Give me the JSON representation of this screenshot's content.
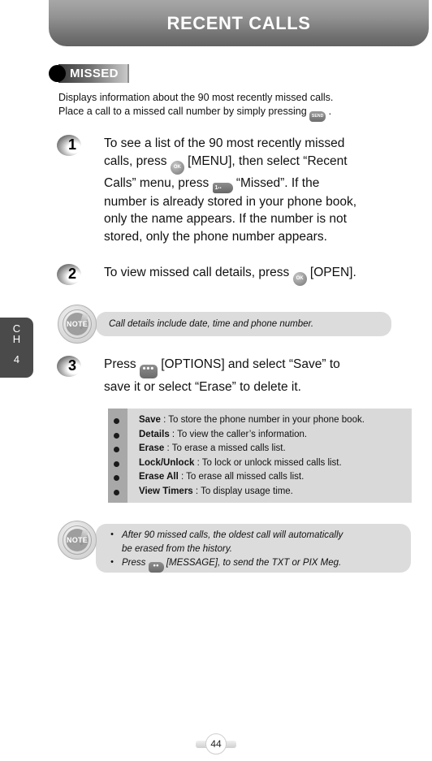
{
  "header": {
    "title": "RECENT CALLS"
  },
  "chapter_tab": {
    "letter1": "C",
    "letter2": "H",
    "number": "4"
  },
  "section": {
    "badge_label": "MISSED",
    "intro_line1": "Displays information about the 90 most recently missed calls.",
    "intro_line2a": "Place a call to a missed call number by simply pressing",
    "intro_line2b": ".",
    "intro_key": "SEND"
  },
  "steps": [
    {
      "number": "1",
      "line1": "To see a list of the 90 most recently missed",
      "line2a": "calls, press",
      "key1": "OK",
      "line2b": "[MENU], then select “Recent",
      "line3a": "Calls” menu, press",
      "key2": "1",
      "line3b": "“Missed”. If the",
      "line4": "number is already stored in your phone book,",
      "line5": "only the name appears. If the number is not",
      "line6": "stored, only the phone number appears."
    },
    {
      "number": "2",
      "line1a": "To view missed call details, press",
      "key1": "OK",
      "line1b": "[OPEN]."
    },
    {
      "number": "3",
      "line1a": "Press",
      "key1": "•••",
      "line1b": "[OPTIONS] and select “Save” to",
      "line2": "save it or select “Erase” to delete it."
    }
  ],
  "note1": {
    "icon_label": "NOTE",
    "text": "Call details include date, time and phone number."
  },
  "options": {
    "items": [
      {
        "name": "Save",
        "desc": ": To store the phone number in your phone book."
      },
      {
        "name": "Details",
        "desc": ": To view the caller’s information."
      },
      {
        "name": "Erase",
        "desc": ": To erase a missed calls list."
      },
      {
        "name": "Lock/Unlock",
        "desc": ": To lock or unlock missed calls list."
      },
      {
        "name": "Erase All",
        "desc": ": To erase all missed calls list."
      },
      {
        "name": "View Timers",
        "desc": ": To display usage time."
      }
    ]
  },
  "note2": {
    "icon_label": "NOTE",
    "item1_line1": "After 90 missed calls, the oldest call will automatically",
    "item1_line2": "be erased from the history.",
    "item2_a": "Press",
    "item2_key": "••",
    "item2_b": "[MESSAGE], to send the TXT or PIX Meg."
  },
  "footer": {
    "page_number": "44"
  }
}
